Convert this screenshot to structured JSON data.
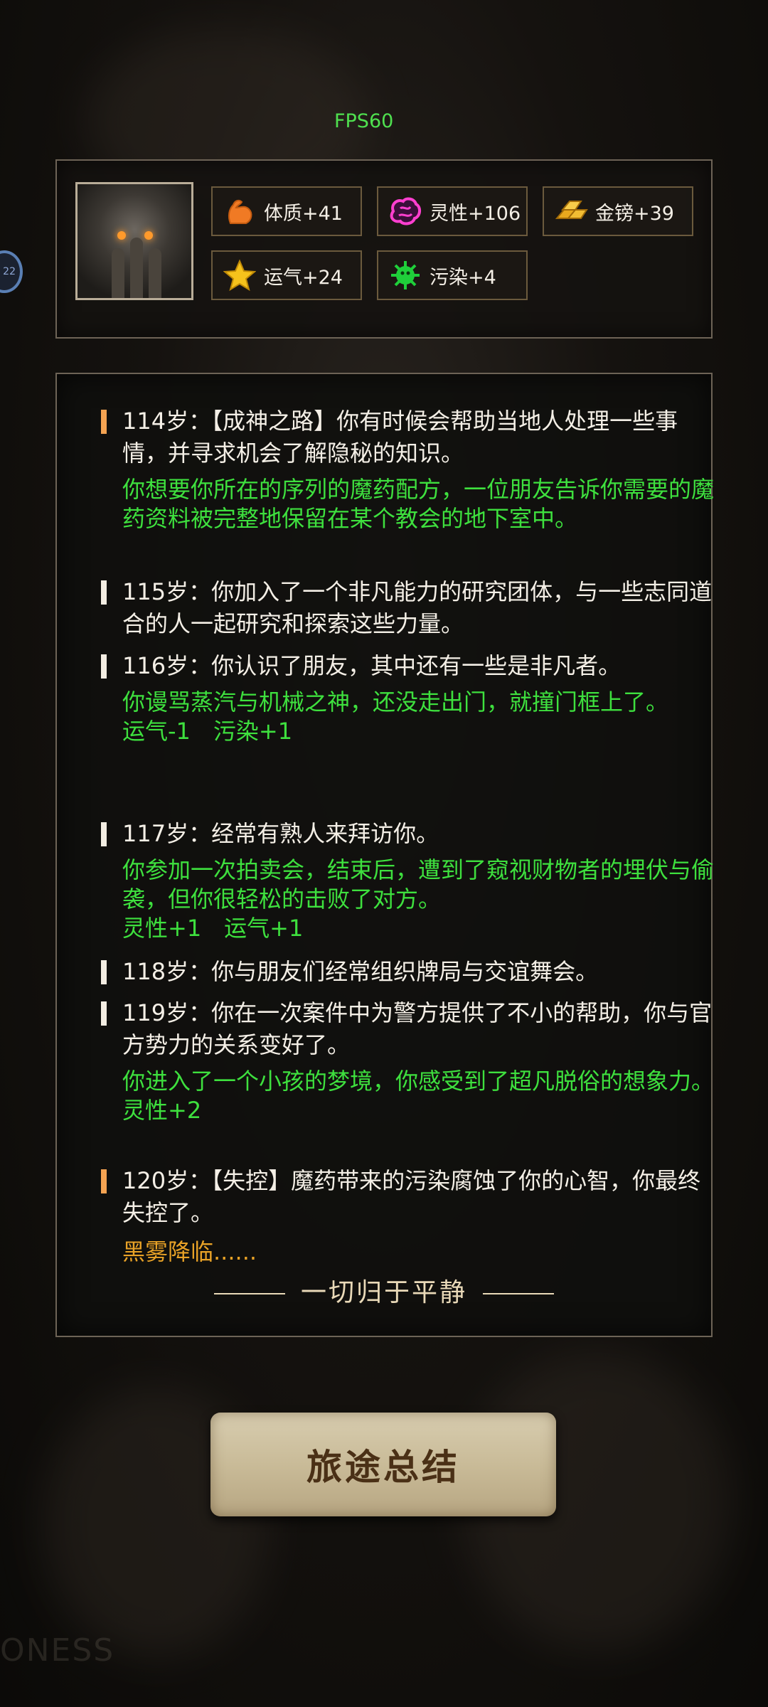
{
  "fps": "FPS60",
  "side_badge": "22",
  "stats": [
    {
      "icon": "muscle-icon",
      "label": "体质+41"
    },
    {
      "icon": "brain-icon",
      "label": "灵性+106"
    },
    {
      "icon": "gold-bars-icon",
      "label": "金镑+39"
    },
    {
      "icon": "star-icon",
      "label": "运气+24"
    },
    {
      "icon": "virus-icon",
      "label": "污染+4"
    }
  ],
  "log": [
    {
      "text": "114岁：【成神之路】你有时候会帮助当地人处理一些事情，并寻求机会了解隐秘的知识。",
      "green": "你想要你所在的序列的魔药配方，一位朋友告诉你需要的魔药资料被完整地保留在某个教会的地下室中。"
    },
    {
      "text": "115岁：你加入了一个非凡能力的研究团体，与一些志同道合的人一起研究和探索这些力量。"
    },
    {
      "text": "116岁：你认识了朋友，其中还有一些是非凡者。",
      "green": "你谩骂蒸汽与机械之神，还没走出门，就撞门框上了。",
      "effects": "运气-1　污染+1"
    },
    {
      "text": "117岁：经常有熟人来拜访你。",
      "green": "你参加一次拍卖会，结束后，遭到了窥视财物者的埋伏与偷袭，但你很轻松的击败了对方。",
      "effects": "灵性+1　运气+1"
    },
    {
      "text": "118岁：你与朋友们经常组织牌局与交谊舞会。"
    },
    {
      "text": "119岁：你在一次案件中为警方提供了不小的帮助，你与官方势力的关系变好了。",
      "green": "你进入了一个小孩的梦境，你感受到了超凡脱俗的想象力。",
      "effects": "灵性+2"
    },
    {
      "text": "120岁：【失控】魔药带来的污染腐蚀了你的心智，你最终失控了。",
      "warning": "黑雾降临......"
    }
  ],
  "ending": "一切归于平静",
  "summary_button": "旅途总结",
  "watermark": "ONESS",
  "colors": {
    "accent_green": "#3ee03e",
    "warning_yellow": "#e8a227",
    "bar_orange": "#f4a352"
  }
}
